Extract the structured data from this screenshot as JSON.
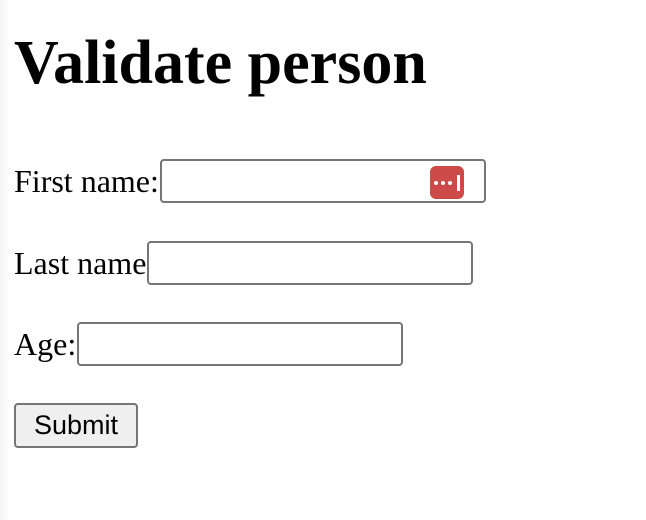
{
  "page": {
    "title": "Validate person"
  },
  "form": {
    "first_name": {
      "label": "First name:",
      "value": ""
    },
    "last_name": {
      "label": "Last name",
      "value": ""
    },
    "age": {
      "label": "Age:",
      "value": ""
    },
    "submit_label": "Submit"
  },
  "icons": {
    "password_manager": "password-manager-icon"
  },
  "colors": {
    "password_manager_icon_bg": "#cc4b48",
    "input_border": "#767676",
    "button_bg": "#efefef"
  }
}
